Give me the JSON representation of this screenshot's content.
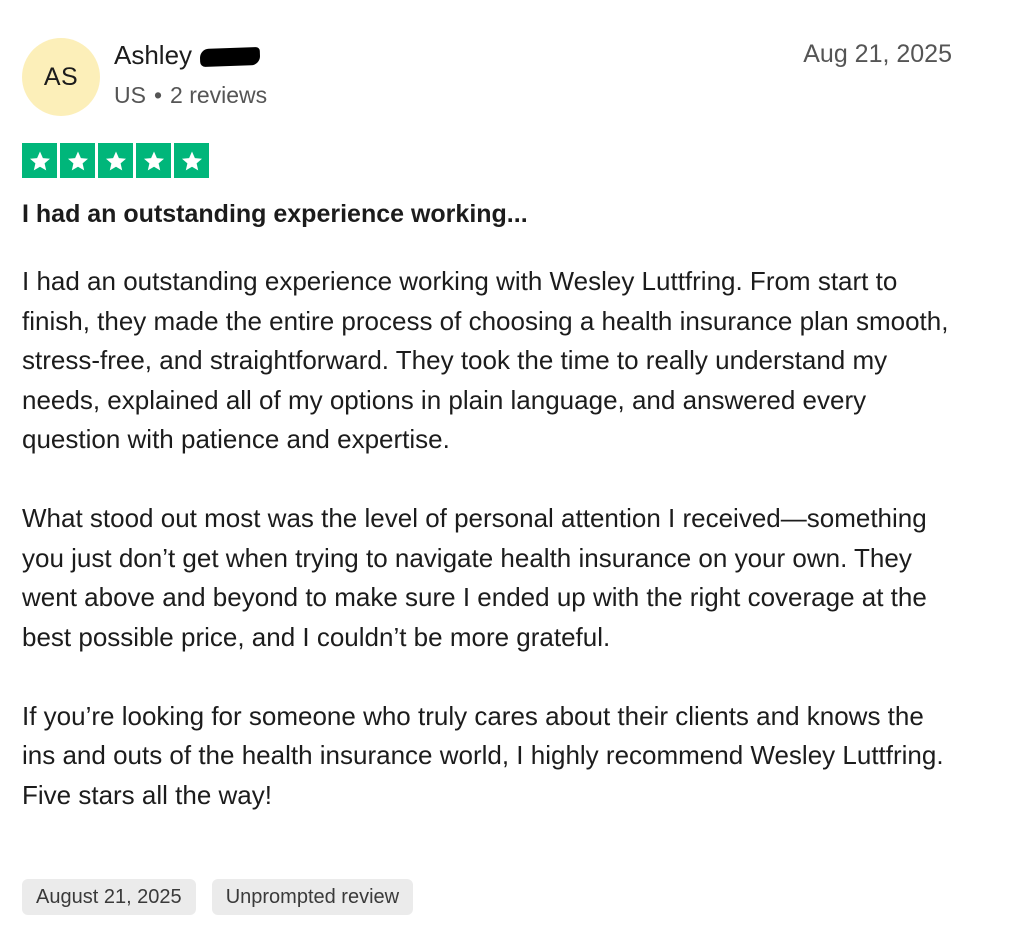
{
  "reviewer": {
    "initials": "AS",
    "name": "Ashley",
    "country": "US",
    "separator": "•",
    "review_count": "2 reviews"
  },
  "review": {
    "date": "Aug 21, 2025",
    "rating": 5,
    "rating_max": 5,
    "star_color": "#00b67a",
    "title": "I had an outstanding experience working...",
    "paragraphs": [
      "I had an outstanding experience working with Wesley Luttfring. From start to finish, they made the entire process of choosing a health insurance plan smooth, stress-free, and straightforward. They took the time to really understand my needs, explained all of my options in plain language, and answered every question with patience and expertise.",
      "What stood out most was the level of personal attention I received—something you just don’t get when trying to navigate health insurance on your own. They went above and beyond to make sure I ended up with the right coverage at the best possible price, and I couldn’t be more grateful.",
      "If you’re looking for someone who truly cares about their clients and knows the ins and outs of the health insurance world, I highly recommend Wesley Luttfring. Five stars all the way!"
    ],
    "tags": {
      "experience_date": "August 21, 2025",
      "source": "Unprompted review"
    }
  },
  "colors": {
    "avatar_bg": "#fcefb9",
    "star_green": "#00b67a",
    "tag_bg": "#ebebeb"
  }
}
